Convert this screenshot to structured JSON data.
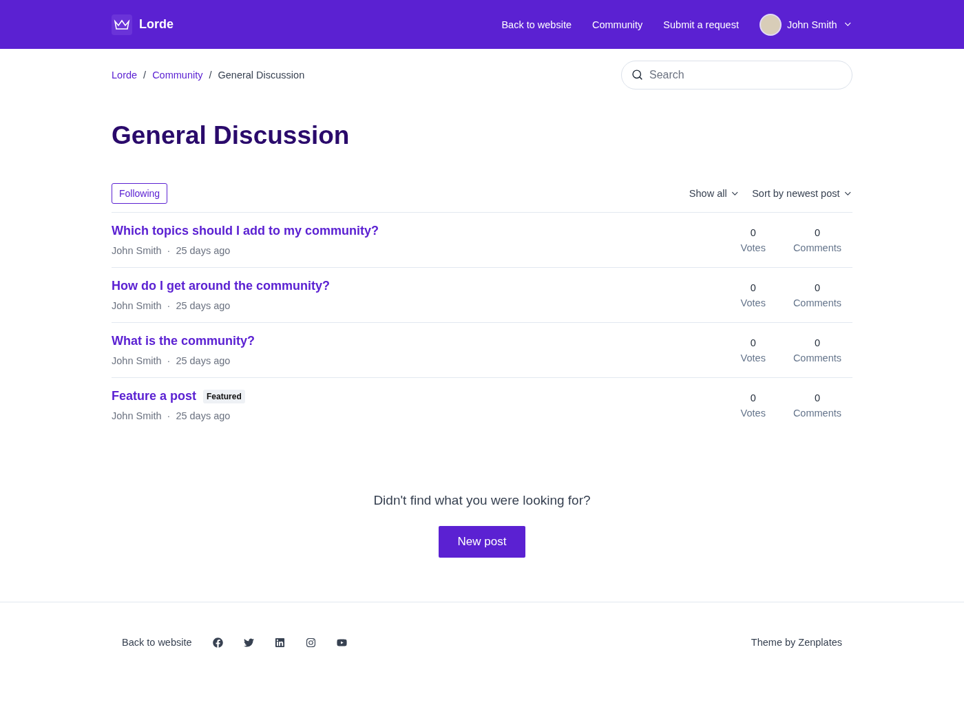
{
  "header": {
    "brand": "Lorde",
    "nav": [
      "Back to website",
      "Community",
      "Submit a request"
    ],
    "user": "John Smith"
  },
  "breadcrumb": {
    "separator": "/",
    "items": [
      {
        "label": "Lorde",
        "current": false
      },
      {
        "label": "Community",
        "current": false
      },
      {
        "label": "General Discussion",
        "current": true
      }
    ]
  },
  "search": {
    "placeholder": "Search"
  },
  "title": "General Discussion",
  "follow_button": "Following",
  "filters": [
    "Show all",
    "Sort by newest post"
  ],
  "posts": [
    {
      "title": "Which topics should I add to my community?",
      "author": "John Smith",
      "separator": "·",
      "time": "25 days ago",
      "votes": "0",
      "votes_label": "Votes",
      "comments": "0",
      "comments_label": "Comments"
    },
    {
      "title": "How do I get around the community?",
      "author": "John Smith",
      "separator": "·",
      "time": "25 days ago",
      "votes": "0",
      "votes_label": "Votes",
      "comments": "0",
      "comments_label": "Comments"
    },
    {
      "title": "What is the community?",
      "author": "John Smith",
      "separator": "·",
      "time": "25 days ago",
      "votes": "0",
      "votes_label": "Votes",
      "comments": "0",
      "comments_label": "Comments"
    },
    {
      "title": "Feature a post",
      "badge": "Featured",
      "author": "John Smith",
      "separator": "·",
      "time": "25 days ago",
      "votes": "0",
      "votes_label": "Votes",
      "comments": "0",
      "comments_label": "Comments"
    }
  ],
  "cta": {
    "text": "Didn't find what you were looking for?",
    "button": "New post"
  },
  "footer": {
    "link": "Back to website",
    "credit": "Theme by Zenplates"
  }
}
